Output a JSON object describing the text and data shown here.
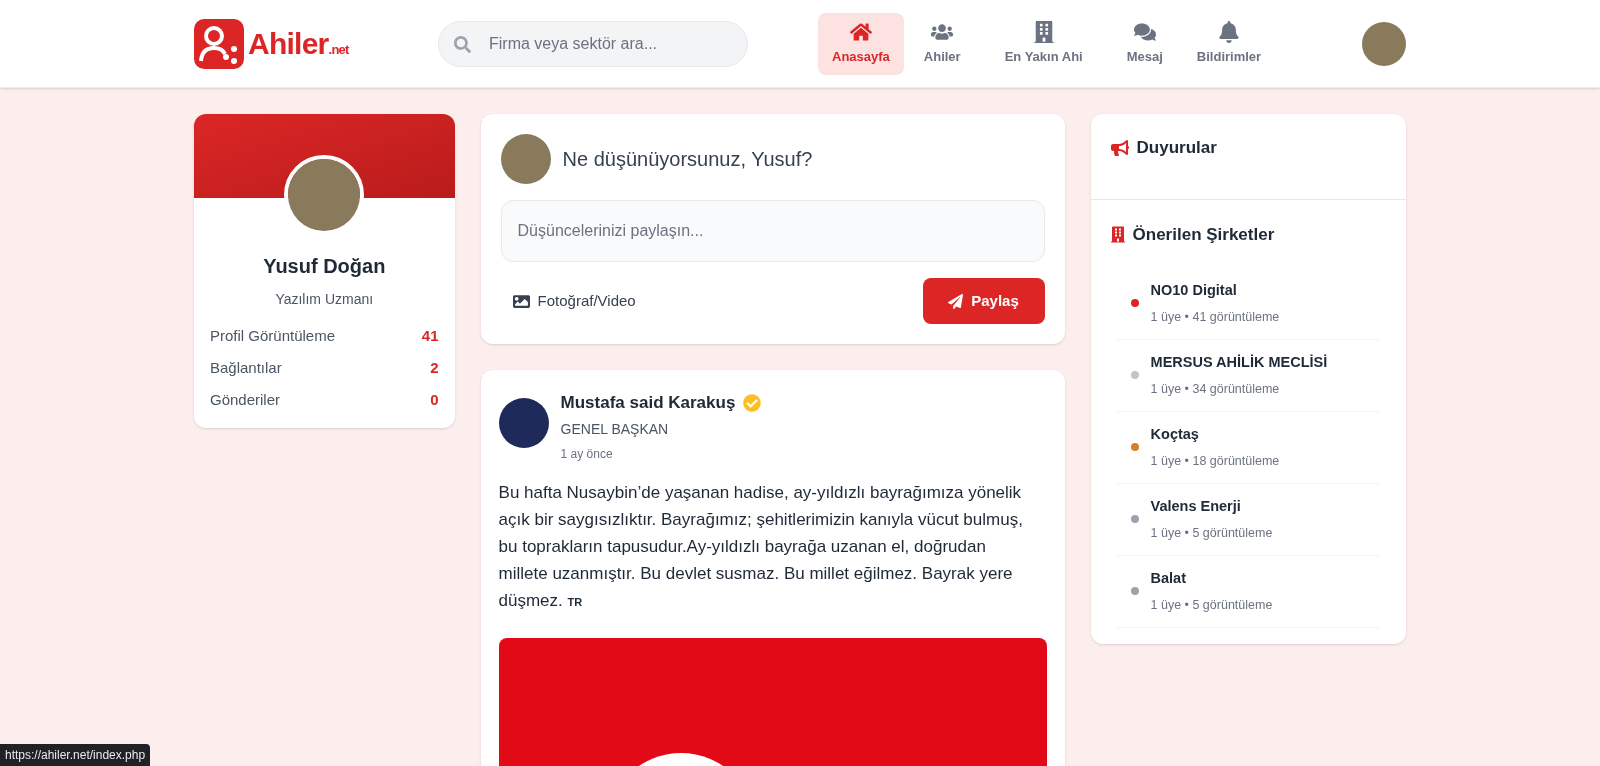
{
  "header": {
    "logo": {
      "name": "Ahiler",
      "suffix": ".net"
    },
    "search": {
      "placeholder": "Firma veya sektör ara..."
    },
    "nav": [
      {
        "kind": "home",
        "label": "Anasayfa",
        "selected": true
      },
      {
        "kind": "users",
        "label": "Ahiler",
        "selected": false
      },
      {
        "kind": "building",
        "label": "En Yakın Ahi",
        "selected": false
      },
      {
        "kind": "chat",
        "label": "Mesaj",
        "selected": false
      },
      {
        "kind": "bell",
        "label": "Bildirimler",
        "selected": false
      }
    ]
  },
  "profile": {
    "name": "Yusuf Doğan",
    "title": "Yazılım Uzmanı",
    "stats": [
      {
        "label": "Profil Görüntüleme",
        "value": "41"
      },
      {
        "label": "Bağlantılar",
        "value": "2"
      },
      {
        "label": "Gönderiler",
        "value": "0"
      }
    ]
  },
  "composer": {
    "prompt": "Ne düşünüyorsunuz, Yusuf?",
    "placeholder": "Düşüncelerinizi paylaşın...",
    "media_label": "Fotoğraf/Video",
    "submit": "Paylaş"
  },
  "post": {
    "author": "Mustafa said Karakuş",
    "verified": true,
    "role": "GENEL BAŞKAN",
    "time": "1 ay önce",
    "text": "Bu hafta Nusaybin’de yaşanan hadise, ay-yıldızlı bayrağımıza yönelik açık bir saygısızlıktır. Bayrağımız; şehitlerimizin kanıyla vücut bulmuş, bu toprakların tapusudur.Ay-yıldızlı bayrağa uzanan el, doğrudan millete uzanmıştır. Bu devlet susmaz. Bu millet eğilmez. Bayrak yere düşmez.",
    "flag_code": "TR"
  },
  "announcements": {
    "title": "Duyurular"
  },
  "companies": {
    "title": "Önerilen Şirketler",
    "items": [
      {
        "name": "NO10 Digital",
        "meta": "1 üye • 41 görüntüleme",
        "color": "#dc2626"
      },
      {
        "name": "MERSUS AHİLİK MECLİSİ",
        "meta": "1 üye • 34 görüntüleme",
        "color": "#c4c4c4"
      },
      {
        "name": "Koçtaş",
        "meta": "1 üye • 18 görüntüleme",
        "color": "#d97f2a"
      },
      {
        "name": "Valens Enerji",
        "meta": "1 üye • 5 görüntüleme",
        "color": "#9ca3af"
      },
      {
        "name": "Balat",
        "meta": "1 üye • 5 görüntüleme",
        "color": "#9ca3af"
      }
    ]
  },
  "status_bar": {
    "url": "https://ahiler.net/index.php"
  }
}
